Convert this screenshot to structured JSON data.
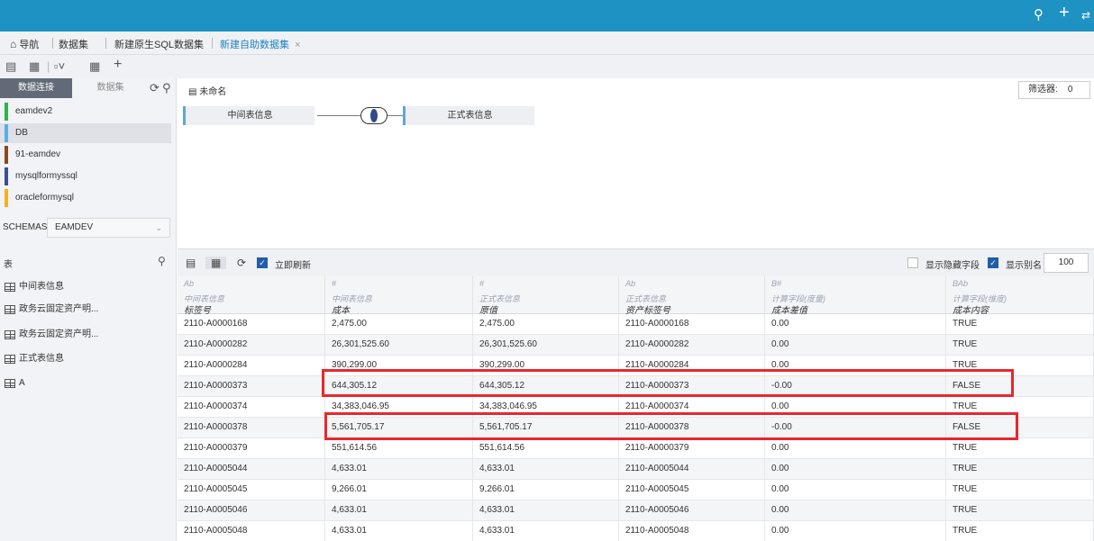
{
  "topbar": {
    "icons": [
      "search-icon",
      "plus-icon",
      "switch-icon"
    ]
  },
  "tabs": [
    {
      "label": "导航",
      "icon": "home-icon"
    },
    {
      "label": "数据集"
    },
    {
      "label": "新建原生SQL数据集"
    },
    {
      "label": "新建自助数据集",
      "close": "×",
      "active": true
    }
  ],
  "toolbar": {
    "icons": [
      "save-icon",
      "save-as-icon",
      "preview-icon",
      "table-icon",
      "add-icon"
    ]
  },
  "left": {
    "tabs": [
      "数据连接",
      "数据集"
    ],
    "connections": [
      {
        "name": "eamdev2",
        "color": "#2fb44a"
      },
      {
        "name": "DB",
        "color": "#5aaee8"
      },
      {
        "name": "91-eamdev",
        "color": "#8a4a1e"
      },
      {
        "name": "mysqlformyssql",
        "color": "#3e4f8f"
      },
      {
        "name": "oracleformysql",
        "color": "#f3b21f"
      }
    ],
    "schemas_label": "SCHEMAS",
    "schema_value": "EAMDEV",
    "tables_title": "表",
    "tables": [
      "中间表信息",
      "政务云固定资产明...",
      "政务云固定资产明...",
      "正式表信息",
      "A"
    ]
  },
  "canvas": {
    "name": "未命名",
    "filter_label": "筛选器:",
    "filter_value": "0",
    "left_node": "中间表信息",
    "right_node": "正式表信息"
  },
  "gridbar": {
    "refresh_label": "立即刷新",
    "hidden_label": "显示隐藏字段",
    "alias_label": "显示别名",
    "row_count": "100"
  },
  "columns": [
    {
      "type": "Ab",
      "source": "中间表信息",
      "field": "标签号"
    },
    {
      "type": "#",
      "source": "中间表信息",
      "field": "成本"
    },
    {
      "type": "#",
      "source": "正式表信息",
      "field": "原值"
    },
    {
      "type": "Ab",
      "source": "正式表信息",
      "field": "资产标签号"
    },
    {
      "type": "B#",
      "source": "计算字段(度量)",
      "field": "成本差值"
    },
    {
      "type": "BAb",
      "source": "计算字段(维度)",
      "field": "成本内容"
    }
  ],
  "rows": [
    [
      "2110-A0000168",
      "2,475.00",
      "2,475.00",
      "2110-A0000168",
      "0.00",
      "TRUE"
    ],
    [
      "2110-A0000282",
      "26,301,525.60",
      "26,301,525.60",
      "2110-A0000282",
      "0.00",
      "TRUE"
    ],
    [
      "2110-A0000284",
      "390,299.00",
      "390,299.00",
      "2110-A0000284",
      "0.00",
      "TRUE"
    ],
    [
      "2110-A0000373",
      "644,305.12",
      "644,305.12",
      "2110-A0000373",
      "-0.00",
      "FALSE"
    ],
    [
      "2110-A0000374",
      "34,383,046.95",
      "34,383,046.95",
      "2110-A0000374",
      "0.00",
      "TRUE"
    ],
    [
      "2110-A0000378",
      "5,561,705.17",
      "5,561,705.17",
      "2110-A0000378",
      "-0.00",
      "FALSE"
    ],
    [
      "2110-A0000379",
      "551,614.56",
      "551,614.56",
      "2110-A0000379",
      "0.00",
      "TRUE"
    ],
    [
      "2110-A0005044",
      "4,633.01",
      "4,633.01",
      "2110-A0005044",
      "0.00",
      "TRUE"
    ],
    [
      "2110-A0005045",
      "9,266.01",
      "9,266.01",
      "2110-A0005045",
      "0.00",
      "TRUE"
    ],
    [
      "2110-A0005046",
      "4,633.01",
      "4,633.01",
      "2110-A0005046",
      "0.00",
      "TRUE"
    ],
    [
      "2110-A0005048",
      "4,633.01",
      "4,633.01",
      "2110-A0005048",
      "0.00",
      "TRUE"
    ]
  ],
  "highlight_color": "#e8272d"
}
